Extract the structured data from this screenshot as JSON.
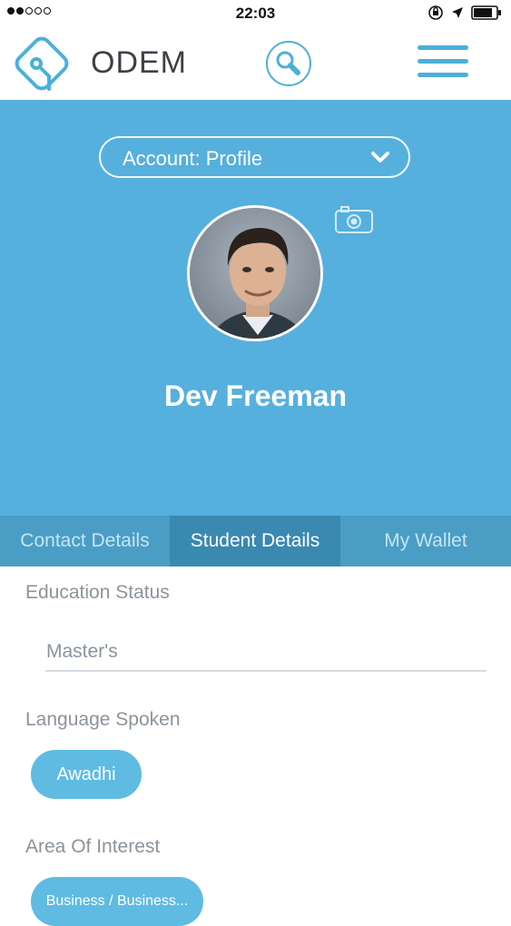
{
  "status_bar": {
    "time": "22:03"
  },
  "header": {
    "brand": "ODEM",
    "icons": {
      "logo": "odem-logo-icon",
      "search": "search-icon",
      "menu": "hamburger-menu-icon"
    }
  },
  "profile": {
    "account_select": {
      "value": "Account: Profile"
    },
    "user_name": "Dev Freeman"
  },
  "tabs": [
    {
      "label": "Contact Details",
      "active": false
    },
    {
      "label": "Student Details",
      "active": true
    },
    {
      "label": "My Wallet",
      "active": false
    }
  ],
  "student_details": {
    "education_status": {
      "label": "Education Status",
      "value": "Master's"
    },
    "language_spoken": {
      "label": "Language Spoken",
      "chips": [
        "Awadhi"
      ]
    },
    "area_of_interest": {
      "label": "Area Of Interest",
      "chips": [
        "Business / Business..."
      ]
    }
  },
  "colors": {
    "primary": "#56b0dd",
    "tab_active": "#3a89b0",
    "chip": "#5fbbe2"
  }
}
